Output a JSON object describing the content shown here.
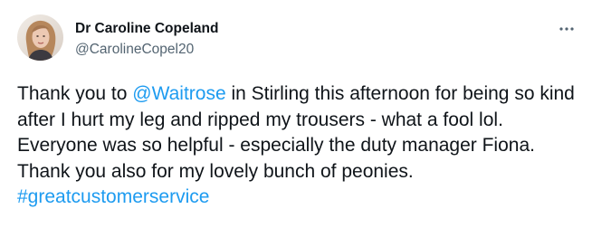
{
  "author": {
    "display_name": "Dr Caroline Copeland",
    "handle": "@CarolineCopel20",
    "avatar_icon": "profile-photo"
  },
  "menu": {
    "icon": "more-horizontal-icon"
  },
  "tweet": {
    "segments": {
      "t1": "Thank you to ",
      "mention": "@Waitrose",
      "t2": " in Stirling this afternoon for being so kind after I hurt my leg and ripped my trousers - what a fool lol. Everyone was so helpful - especially the duty manager Fiona. Thank you also for my lovely bunch of peonies. ",
      "hashtag": "#greatcustomerservice"
    }
  },
  "colors": {
    "text": "#0f1419",
    "secondary": "#536471",
    "link": "#1d9bf0",
    "background": "#ffffff"
  }
}
